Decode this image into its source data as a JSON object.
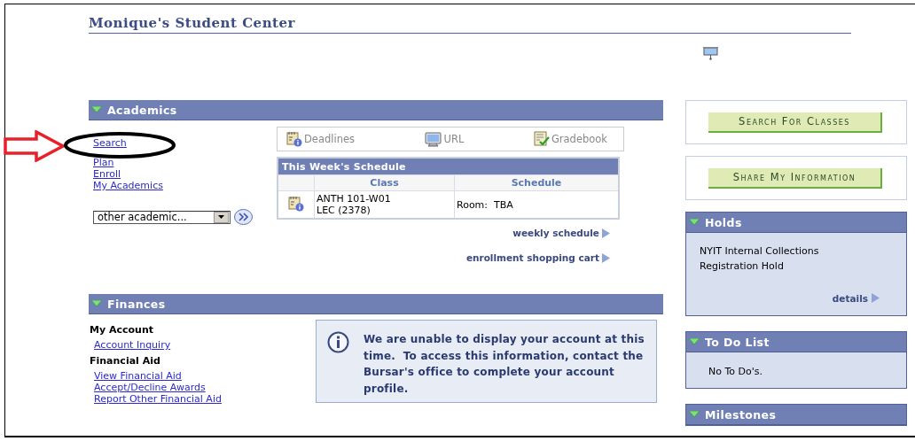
{
  "page": {
    "title": "Monique's Student Center"
  },
  "academics": {
    "title": "Academics",
    "expanded": true,
    "links": [
      {
        "label": "Search"
      },
      {
        "label": "Plan"
      },
      {
        "label": "Enroll"
      },
      {
        "label": "My Academics"
      }
    ],
    "dropdown": {
      "value": "other academic..."
    },
    "quick_links": [
      {
        "label": "Deadlines",
        "kind": "deadlines"
      },
      {
        "label": "URL",
        "kind": "url"
      },
      {
        "label": "Gradebook",
        "kind": "gradebook"
      }
    ],
    "schedule": {
      "title": "This Week's Schedule",
      "columns": [
        "Class",
        "Schedule"
      ],
      "rows": [
        {
          "class": [
            "ANTH 101-W01",
            "LEC (2378)"
          ],
          "schedule": "Room:  TBA"
        }
      ]
    },
    "more_links": [
      "weekly schedule",
      "enrollment shopping cart"
    ]
  },
  "finances": {
    "title": "Finances",
    "expanded": true,
    "groups": [
      {
        "heading": "My Account",
        "links": [
          "Account Inquiry"
        ]
      },
      {
        "heading": "Financial Aid",
        "links": [
          "View Financial Aid",
          "Accept/Decline Awards",
          "Report Other Financial Aid"
        ]
      }
    ],
    "notice": "We are unable to display your account at this time.  To access this information, contact the Bursar's office to complete your account profile."
  },
  "side_buttons": [
    "Search For Classes",
    "Share My Information"
  ],
  "holds": {
    "title": "Holds",
    "expanded": true,
    "items": [
      "NYIT Internal Collections",
      "Registration Hold"
    ],
    "link": "details"
  },
  "todo": {
    "title": "To Do List",
    "expanded": true,
    "items": [
      "No To Do's."
    ]
  },
  "milestones": {
    "title": "Milestones",
    "expanded": true
  }
}
